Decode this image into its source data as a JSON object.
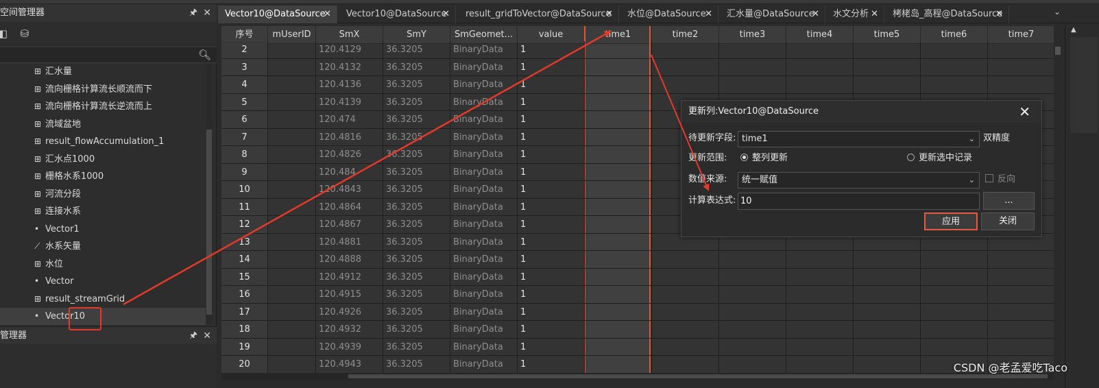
{
  "left_panel": {
    "workspace_title": "空间管理器",
    "search_placeholder": "",
    "tree_items": [
      {
        "label": "汇水量",
        "icon": "grid-icon"
      },
      {
        "label": "流向栅格计算流长顺流而下",
        "icon": "grid-icon"
      },
      {
        "label": "流向栅格计算流长逆流而上",
        "icon": "grid-icon"
      },
      {
        "label": "流域盆地",
        "icon": "grid-icon"
      },
      {
        "label": "result_flowAccumulation_1",
        "icon": "grid-icon"
      },
      {
        "label": "汇水点1000",
        "icon": "grid-icon"
      },
      {
        "label": "栅格水系1000",
        "icon": "grid-icon"
      },
      {
        "label": "河流分段",
        "icon": "grid-icon"
      },
      {
        "label": "连接水系",
        "icon": "grid-icon"
      },
      {
        "label": "Vector1",
        "icon": "point-icon"
      },
      {
        "label": "水系矢量",
        "icon": "line-icon"
      },
      {
        "label": "水位",
        "icon": "grid-icon"
      },
      {
        "label": "Vector",
        "icon": "point-icon"
      },
      {
        "label": "result_streamGrid",
        "icon": "grid-icon"
      },
      {
        "label": "Vector10",
        "icon": "point-icon"
      }
    ],
    "lower_title": "管理器"
  },
  "tabs": [
    {
      "label": "Vector10@DataSource",
      "active": true
    },
    {
      "label": "Vector10@DataSource",
      "active": false
    },
    {
      "label": "result_gridToVector@DataSource",
      "active": false
    },
    {
      "label": "水位@DataSource",
      "active": false
    },
    {
      "label": "汇水量@DataSource",
      "active": false
    },
    {
      "label": "水文分析",
      "active": false
    },
    {
      "label": "栲栳岛_高程@DataSource",
      "active": false
    }
  ],
  "grid": {
    "columns": [
      "序号",
      "mUserID",
      "SmX",
      "SmY",
      "SmGeomet...",
      "value",
      "time1",
      "time2",
      "time3",
      "time4",
      "time5",
      "time6",
      "time7"
    ],
    "rows": [
      [
        "2",
        "",
        "120.4129",
        "36.3205",
        "BinaryData",
        "1"
      ],
      [
        "3",
        "",
        "120.4132",
        "36.3205",
        "BinaryData",
        "1"
      ],
      [
        "4",
        "",
        "120.4136",
        "36.3205",
        "BinaryData",
        "1"
      ],
      [
        "5",
        "",
        "120.4139",
        "36.3205",
        "BinaryData",
        "1"
      ],
      [
        "6",
        "",
        "120.474",
        "36.3205",
        "BinaryData",
        "1"
      ],
      [
        "7",
        "",
        "120.4816",
        "36.3205",
        "BinaryData",
        "1"
      ],
      [
        "8",
        "",
        "120.4826",
        "36.3205",
        "BinaryData",
        "1"
      ],
      [
        "9",
        "",
        "120.484",
        "36.3205",
        "BinaryData",
        "1"
      ],
      [
        "10",
        "",
        "120.4843",
        "36.3205",
        "BinaryData",
        "1"
      ],
      [
        "11",
        "",
        "120.4864",
        "36.3205",
        "BinaryData",
        "1"
      ],
      [
        "12",
        "",
        "120.4867",
        "36.3205",
        "BinaryData",
        "1"
      ],
      [
        "13",
        "",
        "120.4881",
        "36.3205",
        "BinaryData",
        "1"
      ],
      [
        "14",
        "",
        "120.4888",
        "36.3205",
        "BinaryData",
        "1"
      ],
      [
        "15",
        "",
        "120.4912",
        "36.3205",
        "BinaryData",
        "1"
      ],
      [
        "16",
        "",
        "120.4915",
        "36.3205",
        "BinaryData",
        "1"
      ],
      [
        "17",
        "",
        "120.4926",
        "36.3205",
        "BinaryData",
        "1"
      ],
      [
        "18",
        "",
        "120.4932",
        "36.3205",
        "BinaryData",
        "1"
      ],
      [
        "19",
        "",
        "120.4939",
        "36.3205",
        "BinaryData",
        "1"
      ],
      [
        "20",
        "",
        "120.4943",
        "36.3205",
        "BinaryData",
        "1"
      ]
    ]
  },
  "dialog": {
    "title": "更新列:Vector10@DataSource",
    "field_label": "待更新字段:",
    "field_value": "time1",
    "field_type": "双精度",
    "range_label": "更新范围:",
    "range_option_all": "整列更新",
    "range_option_selected": "更新选中记录",
    "source_label": "数值来源:",
    "source_value": "统一赋值",
    "reverse_label": "反向",
    "expr_label": "计算表达式:",
    "expr_value": "10",
    "ellipsis_button": "...",
    "apply_button": "应用",
    "close_button": "关闭"
  },
  "watermark": "CSDN @老孟爱吃Taco",
  "colors": {
    "annotation_red": "#e53a2a",
    "selected_column_border": "#d9583c"
  }
}
